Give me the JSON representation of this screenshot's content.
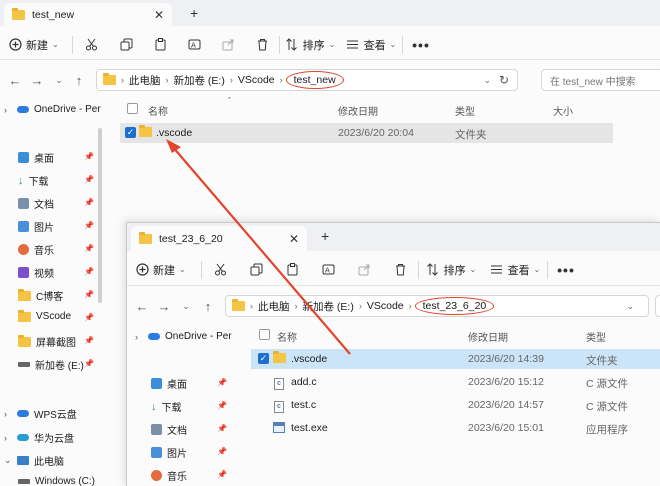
{
  "window1": {
    "tab": {
      "label": "test_new",
      "close": "✕"
    },
    "new_tab": "+",
    "toolbar": {
      "new": "新建",
      "sort": "排序",
      "view": "查看",
      "more": "•••"
    },
    "address": {
      "crumbs": [
        "此电脑",
        "新加卷 (E:)",
        "VScode",
        "test_new"
      ],
      "refresh": "↻"
    },
    "search_placeholder": "在 test_new 中搜索",
    "nav": [
      {
        "label": "OneDrive - Per",
        "icon": "onedrive-icon"
      },
      {
        "label": "桌面",
        "icon": "desktop-icon"
      },
      {
        "label": "下载",
        "icon": "download-icon"
      },
      {
        "label": "文档",
        "icon": "document-icon"
      },
      {
        "label": "图片",
        "icon": "pictures-icon"
      },
      {
        "label": "音乐",
        "icon": "music-icon"
      },
      {
        "label": "视频",
        "icon": "video-icon"
      },
      {
        "label": "C博客",
        "icon": "folder-icon"
      },
      {
        "label": "VScode",
        "icon": "folder-icon"
      },
      {
        "label": "屏幕截图",
        "icon": "folder-icon"
      },
      {
        "label": "新加卷 (E:)",
        "icon": "drive-icon"
      },
      {
        "label": "WPS云盘",
        "icon": "wps-cloud-icon"
      },
      {
        "label": "华为云盘",
        "icon": "huawei-cloud-icon"
      },
      {
        "label": "此电脑",
        "icon": "this-pc-icon"
      },
      {
        "label": "Windows (C:)",
        "icon": "drive-icon"
      }
    ],
    "columns": {
      "name": "名称",
      "date": "修改日期",
      "type": "类型",
      "size": "大小"
    },
    "files": [
      {
        "name": ".vscode",
        "date": "2023/6/20 20:04",
        "type": "文件夹",
        "size": ""
      }
    ]
  },
  "window2": {
    "tab": {
      "label": "test_23_6_20",
      "close": "✕"
    },
    "new_tab": "+",
    "toolbar": {
      "new": "新建",
      "sort": "排序",
      "view": "查看",
      "more": "•••"
    },
    "address": {
      "crumbs": [
        "此电脑",
        "新加卷 (E:)",
        "VScode",
        "test_23_6_20"
      ]
    },
    "nav": [
      {
        "label": "OneDrive - Per",
        "icon": "onedrive-icon"
      },
      {
        "label": "桌面",
        "icon": "desktop-icon"
      },
      {
        "label": "下载",
        "icon": "download-icon"
      },
      {
        "label": "文档",
        "icon": "document-icon"
      },
      {
        "label": "图片",
        "icon": "pictures-icon"
      },
      {
        "label": "音乐",
        "icon": "music-icon"
      }
    ],
    "columns": {
      "name": "名称",
      "date": "修改日期",
      "type": "类型"
    },
    "files": [
      {
        "name": ".vscode",
        "date": "2023/6/20 14:39",
        "type": "文件夹"
      },
      {
        "name": "add.c",
        "date": "2023/6/20 15:12",
        "type": "C 源文件"
      },
      {
        "name": "test.c",
        "date": "2023/6/20 14:57",
        "type": "C 源文件"
      },
      {
        "name": "test.exe",
        "date": "2023/6/20 15:01",
        "type": "应用程序"
      }
    ]
  },
  "annotation": {
    "color": "#e1452a"
  }
}
